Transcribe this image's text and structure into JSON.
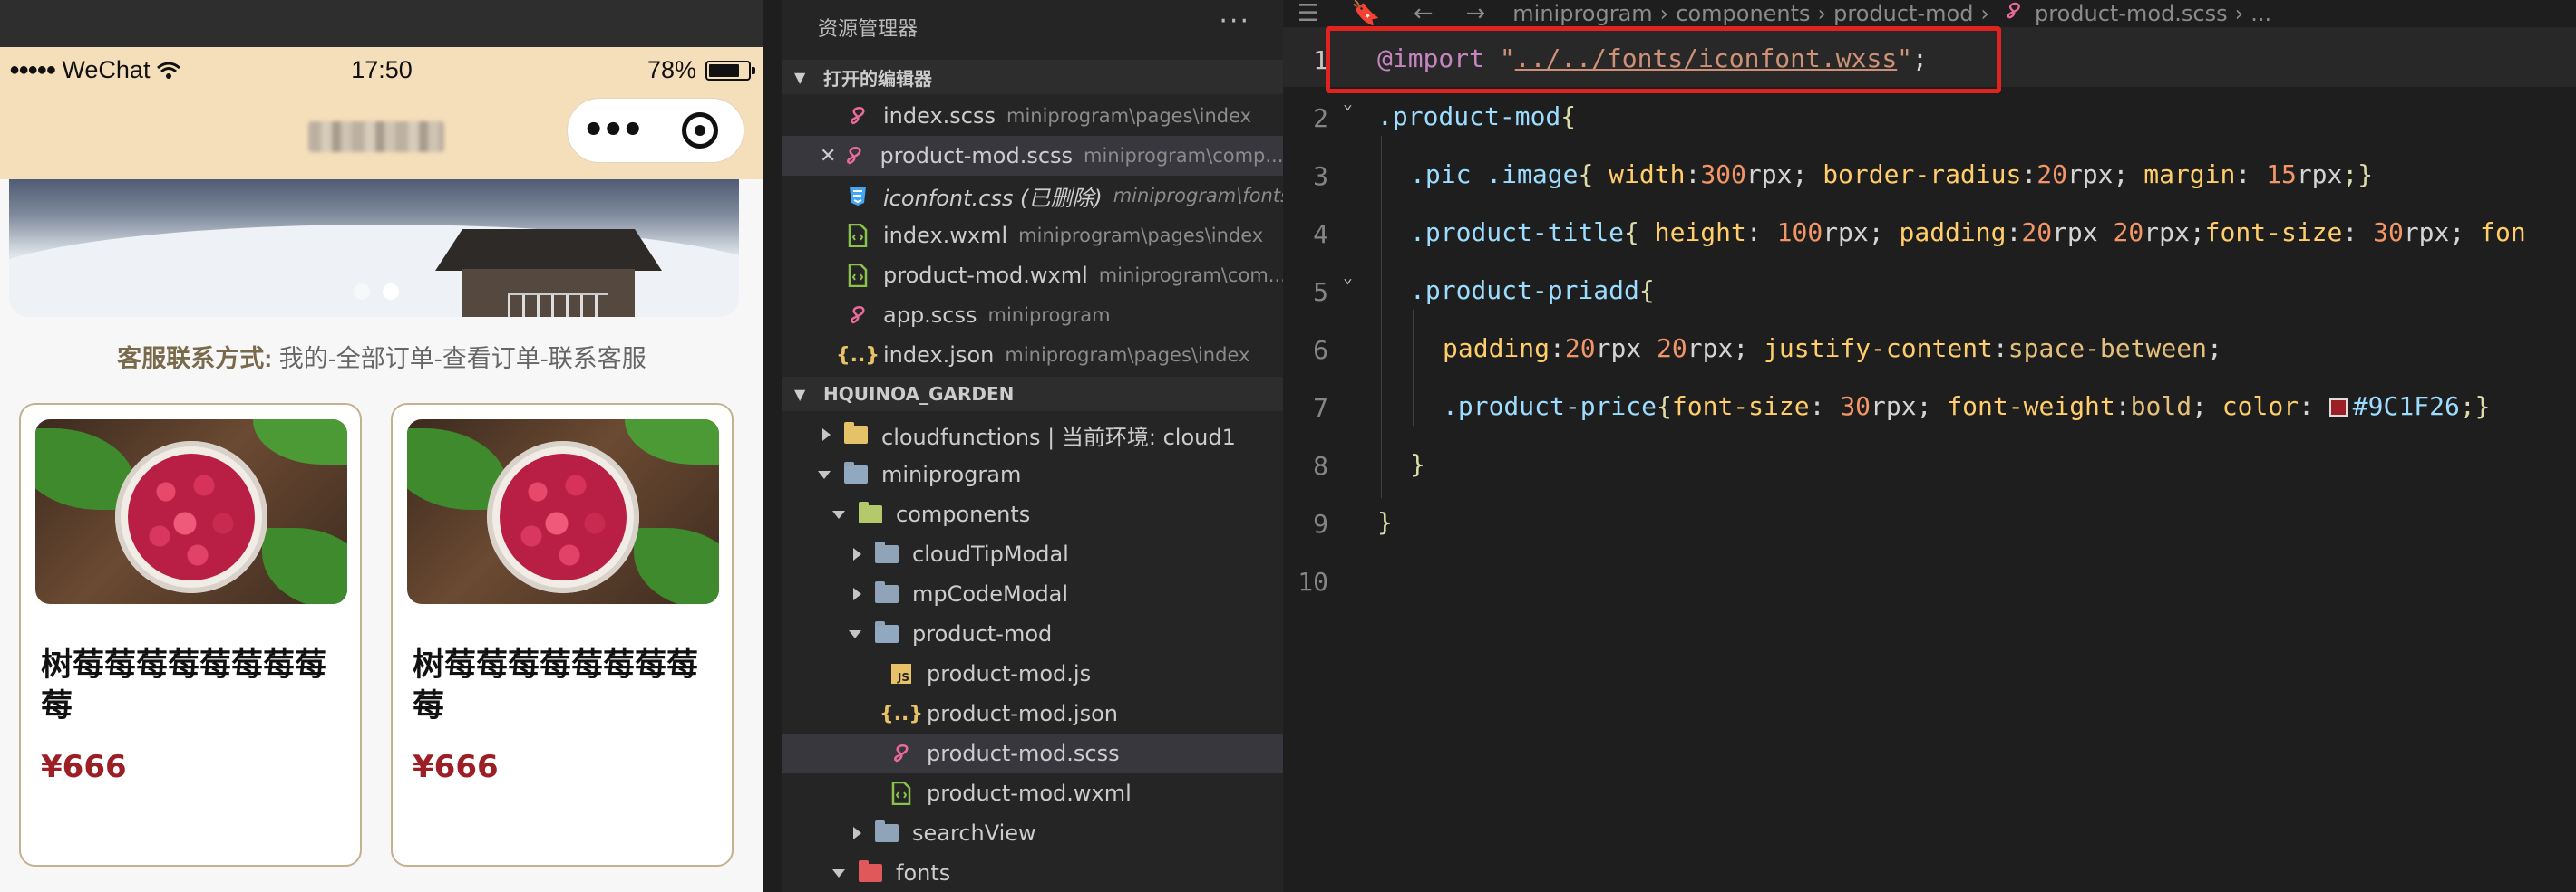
{
  "phone": {
    "status": {
      "carrier": "WeChat",
      "time": "17:50",
      "battery": "78%",
      "battery_level": 0.78
    },
    "service_label": "客服联系方式:",
    "service_text": "我的-全部订单-查看订单-联系客服",
    "products": [
      {
        "name": "树莓莓莓莓莓莓莓莓莓",
        "price": "¥666"
      },
      {
        "name": "树莓莓莓莓莓莓莓莓莓",
        "price": "¥666"
      }
    ],
    "price_color": "#9C1F26"
  },
  "explorer": {
    "title": "资源管理器",
    "open_editors_header": "打开的编辑器",
    "open_editors": [
      {
        "name": "index.scss",
        "path": "miniprogram\\pages\\index",
        "icon": "scss-icon"
      },
      {
        "name": "product-mod.scss",
        "path": "miniprogram\\comp...",
        "icon": "scss-icon"
      },
      {
        "name": "iconfont.css (已删除)",
        "path": "miniprogram\\fonts",
        "icon": "css-icon"
      },
      {
        "name": "index.wxml",
        "path": "miniprogram\\pages\\index",
        "icon": "wxml-icon"
      },
      {
        "name": "product-mod.wxml",
        "path": "miniprogram\\com...",
        "icon": "wxml-icon"
      },
      {
        "name": "app.scss",
        "path": "miniprogram",
        "icon": "scss-icon"
      },
      {
        "name": "index.json",
        "path": "miniprogram\\pages\\index",
        "icon": "json-icon"
      }
    ],
    "project_header": "HQUINOA_GARDEN",
    "tree": {
      "cloudfunctions": "cloudfunctions | 当前环境: cloud1",
      "miniprogram": "miniprogram",
      "components": "components",
      "cloudTipModal": "cloudTipModal",
      "mpCodeModal": "mpCodeModal",
      "product_mod": "product-mod",
      "product_mod_js": "product-mod.js",
      "product_mod_json": "product-mod.json",
      "product_mod_scss": "product-mod.scss",
      "product_mod_wxml": "product-mod.wxml",
      "searchView": "searchView",
      "fonts": "fonts"
    }
  },
  "editor": {
    "breadcrumbs": [
      "miniprogram",
      "components",
      "product-mod",
      "product-mod.scss",
      "..."
    ],
    "line_numbers": [
      "1",
      "2",
      "3",
      "4",
      "5",
      "6",
      "7",
      "8",
      "9",
      "10"
    ],
    "code": {
      "l1_kw": "@import",
      "l1_q1": "\"",
      "l1_url": "../../fonts/iconfont.wxss",
      "l1_q2": "\"",
      "l1_end": ";",
      "l2_sel": ".product-mod",
      "l2_brace": "{",
      "l3": [
        ".pic",
        " .image",
        "{ ",
        "width",
        ":",
        "300",
        "rpx",
        "; ",
        "border-radius",
        ":",
        "20",
        "rpx",
        "; ",
        "margin",
        ": ",
        "15",
        "rpx",
        ";}"
      ],
      "l4": [
        ".product-title",
        "{ ",
        "height",
        ": ",
        "100",
        "rpx",
        "; ",
        "padding",
        ":",
        "20",
        "rpx ",
        "20",
        "rpx",
        ";",
        "font-size",
        ": ",
        "30",
        "rpx",
        "; ",
        "fon"
      ],
      "l5_sel": ".product-priadd",
      "l5_brace": "{",
      "l6": [
        "padding",
        ":",
        "20",
        "rpx ",
        "20",
        "rpx",
        "; ",
        "justify-content",
        ":",
        "space-between",
        ";"
      ],
      "l7": [
        ".product-price",
        "{",
        "font-size",
        ": ",
        "30",
        "rpx",
        "; ",
        "font-weight",
        ":",
        "bold",
        "; ",
        "color",
        ": ",
        "#9C1F26",
        ";}"
      ],
      "l8": "}",
      "l9": "}"
    }
  }
}
